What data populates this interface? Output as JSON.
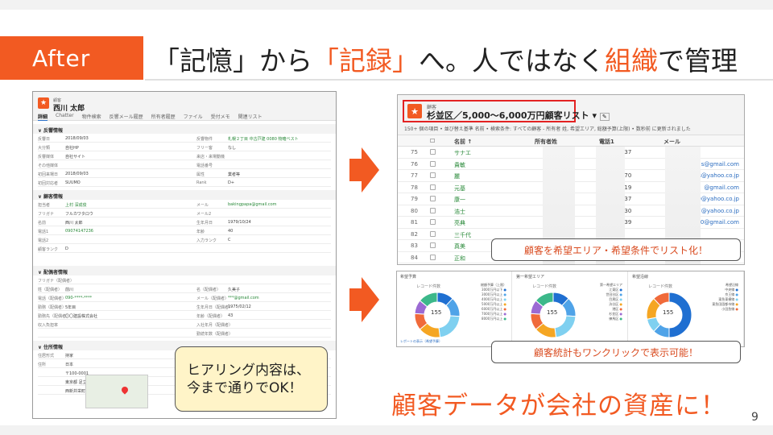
{
  "slide": {
    "after_label": "After",
    "heading_1": "「記憶」から",
    "heading_2": "「記録」",
    "heading_3": "へ。人ではなく",
    "heading_4": "組織",
    "heading_5": "で管理",
    "page_number": "9",
    "big_message": "顧客データが会社の資産に！",
    "accent": "#f25a22"
  },
  "crm": {
    "object_label": "顧客",
    "record_name": "西川 太郎",
    "tabs": [
      "詳細",
      "Chatter",
      "物件検索",
      "反響メール履歴",
      "所有者履歴",
      "ファイル",
      "受付メモ",
      "関連リスト"
    ],
    "sec_basic": "反響情報",
    "basic_rows": [
      {
        "l": "反響日",
        "v": "2018/09/03",
        "l2": "反響物件",
        "v2": "札幌２丁目 中古戸建 0080 物確ベスト"
      },
      {
        "l": "大分類",
        "v": "自社HP",
        "l2": "フリー客",
        "v2": "なし"
      },
      {
        "l": "反響媒体",
        "v": "自社サイト",
        "l2": "来店・来場動機",
        "v2": ""
      },
      {
        "l": "その他媒体",
        "v": "",
        "l2": "電話番号",
        "v2": ""
      },
      {
        "l": "初回来場日",
        "v": "2018/09/03",
        "l2": "属性",
        "v2": "業者等"
      },
      {
        "l": "初回対応者",
        "v": "SUUMO",
        "l2": "Rank",
        "v2": "D+"
      }
    ],
    "sec_customer": "顧客情報",
    "customer_rows": [
      {
        "l": "担当者",
        "v": "上村 深成俊",
        "l2": "メール",
        "v2": "bakingpapa@gmail.com"
      },
      {
        "l": "フリガナ",
        "v": "フルカワタロウ",
        "l2": "メール2",
        "v2": ""
      },
      {
        "l": "名前",
        "v": "西川 太郎",
        "l2": "生年月日",
        "v2": "1979/10/24"
      },
      {
        "l": "電話1",
        "v": "09074147236",
        "l2": "年齢",
        "v2": "40"
      },
      {
        "l": "電話2",
        "v": "",
        "l2": "入力ランク",
        "v2": "C"
      },
      {
        "l": "顧客ランク",
        "v": "D",
        "l2": "",
        "v2": ""
      }
    ],
    "sec_contract": "配偶者情報",
    "contract_rows": [
      {
        "l": "フリガナ（配偶者）",
        "v": "",
        "l2": "",
        "v2": ""
      },
      {
        "l": "姓（配偶者）",
        "v": "前川",
        "l2": "名（配偶者）",
        "v2": "久美子"
      },
      {
        "l": "電話（配偶者）",
        "v": "090-****-****",
        "l2": "メール（配偶者）",
        "v2": "***@gmail.com"
      },
      {
        "l": "勤務（配偶者）",
        "v": "5年目",
        "l2": "生年月日（配偶者）",
        "v2": "1975/02/12"
      },
      {
        "l": "勤務先（配偶者）",
        "v": "〇〇建設株式会社",
        "l2": "年齢（配偶者）",
        "v2": "43"
      },
      {
        "l": "収入負担率",
        "v": "",
        "l2": "入社年月（配偶者）",
        "v2": ""
      },
      {
        "l": "",
        "v": "",
        "l2": "勤続年数（配偶者）",
        "v2": ""
      }
    ],
    "sec_address": "住所情報",
    "address_rows": [
      {
        "l": "住居形式",
        "v": "持家"
      },
      {
        "l": "住所",
        "v": "日本"
      },
      {
        "l": "",
        "v": "〒100-0001"
      },
      {
        "l": "",
        "v": "東京都 足立区"
      },
      {
        "l": "",
        "v": "西新井栄町１－１－２－３"
      }
    ]
  },
  "callouts": {
    "left_line1": "ヒアリング内容は、",
    "left_line2": "今まで通りでOK！",
    "right_list": "顧客を希望エリア・希望条件でリスト化！",
    "right_dash": "顧客統計もワンクリックで表示可能！"
  },
  "list": {
    "object_label": "顧客",
    "title": "杉並区／5,000～6,000万円顧客リスト",
    "subtitle": "150+ 個の項目 • 並び替え基準 名前 • 検索条件: すべての顧客 - 所有者 姓, 希望エリア, 総額予算(上限) • 数秒前 に更新されました",
    "columns": {
      "name": "名前 ↑",
      "owner": "所有者姓",
      "tel": "電話1",
      "mail": "メール"
    },
    "rows": [
      {
        "num": "75",
        "name": "サナエ",
        "tel": "-7337",
        "mail": ""
      },
      {
        "num": "76",
        "name": "貴敏",
        "tel": "",
        "mail": "s@gmail.com"
      },
      {
        "num": "77",
        "name": "麗",
        "tel": "-7170",
        "mail": "s@yahoo.co.jp"
      },
      {
        "num": "78",
        "name": "元基",
        "tel": "-7519",
        "mail": "@gmail.com"
      },
      {
        "num": "79",
        "name": "康一",
        "tel": "-8437",
        "mail": "20@yahoo.co.jp"
      },
      {
        "num": "80",
        "name": "浩士",
        "tel": "-3830",
        "mail": "7@yahoo.co.jp"
      },
      {
        "num": "81",
        "name": "亮典",
        "tel": "-2039",
        "mail": "2110@gmail.com"
      },
      {
        "num": "82",
        "name": "三千代",
        "tel": "",
        "mail": ""
      },
      {
        "num": "83",
        "name": "真美",
        "tel": "",
        "mail": ""
      },
      {
        "num": "84",
        "name": "正和",
        "tel": "-0731",
        "mail": "@hotmail.com"
      }
    ]
  },
  "dashboard": {
    "panels": [
      {
        "title": "希望予算",
        "sub": "レコード件数",
        "center": "155",
        "legend_head": "総額予算（上限）",
        "legend": [
          "3000万円以下",
          "3000万円以上",
          "4000万円以上",
          "5000万円以上",
          "6000万円以上",
          "7000万円以上",
          "8000万円以上"
        ]
      },
      {
        "title": "第一希望エリア",
        "sub": "レコード件数",
        "center": "155",
        "legend_head": "第一希望エリア",
        "legend": [
          "江東区",
          "世田谷区",
          "目黒区",
          "渋谷区",
          "港区",
          "杉並区",
          "練馬区"
        ]
      },
      {
        "title": "希望沿線",
        "sub": "レコード件数",
        "center": "155",
        "legend_head": "希望沿線",
        "legend": [
          "中央線",
          "京王線",
          "東急東横線",
          "東急田園都市線",
          "小田急線"
        ]
      }
    ],
    "link": "レポートの表示（希望予算）"
  }
}
